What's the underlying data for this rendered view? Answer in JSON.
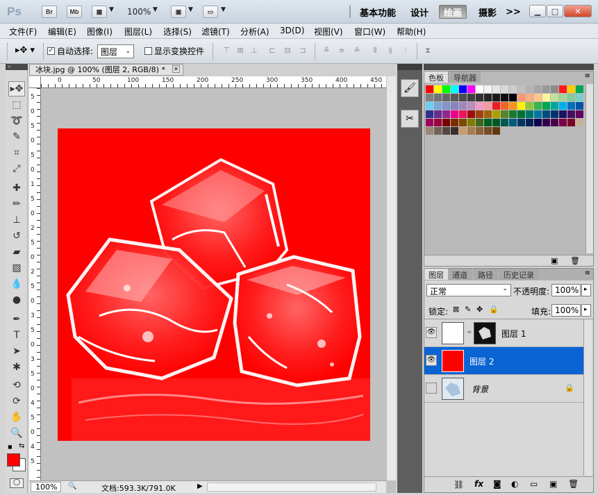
{
  "app": {
    "logo": "Ps",
    "quick_buttons": [
      "Br",
      "Mb"
    ],
    "zoom": "100%",
    "workspaces": [
      "基本功能",
      "设计",
      "绘画",
      "摄影"
    ],
    "active_workspace": "绘画",
    "more": ">>"
  },
  "menu": [
    "文件(F)",
    "编辑(E)",
    "图像(I)",
    "图层(L)",
    "选择(S)",
    "滤镜(T)",
    "分析(A)",
    "3D(D)",
    "视图(V)",
    "窗口(W)",
    "帮助(H)"
  ],
  "options": {
    "auto_select_label": "自动选择:",
    "auto_select_value": "图层",
    "show_transform_label": "显示变换控件"
  },
  "document": {
    "tab_title": "冰块.jpg @ 100% (图层 2, RGB/8) *",
    "ruler_h": [
      "0",
      "50",
      "100",
      "150",
      "200",
      "250",
      "300",
      "350",
      "400",
      "450"
    ],
    "ruler_v": [
      "5",
      "0",
      "5",
      "0",
      "5",
      "0",
      "1",
      "5",
      "0",
      "2",
      "5",
      "0",
      "2",
      "5",
      "0",
      "3",
      "5",
      "0",
      "3",
      "5",
      "0",
      "4",
      "5",
      "0",
      "4",
      "5"
    ],
    "zoom": "100%",
    "doc_size": "文档:593.3K/791.0K"
  },
  "swatches_panel": {
    "tabs": [
      "色板",
      "导航器"
    ],
    "colors": [
      "#ff0000",
      "#ffff00",
      "#00ff00",
      "#00ffff",
      "#0000ff",
      "#ff00ff",
      "#ffffff",
      "#f2f2f2",
      "#e6e6e6",
      "#d9d9d9",
      "#cccccc",
      "#bfbfbf",
      "#b3b3b3",
      "#a6a6a6",
      "#999999",
      "#8c8c8c",
      "#ff1a1a",
      "#ffcc00",
      "#00a651",
      "#808080",
      "#737373",
      "#666666",
      "#595959",
      "#4d4d4d",
      "#404040",
      "#333333",
      "#262626",
      "#1a1a1a",
      "#0d0d0d",
      "#000000",
      "#f7977a",
      "#f9ad81",
      "#fdc68a",
      "#fff79a",
      "#c4df9b",
      "#a3d39c",
      "#82ca9d",
      "#7bcdc8",
      "#6ecff6",
      "#7ea7d8",
      "#8493ca",
      "#8882be",
      "#a187be",
      "#bc8dbf",
      "#f49ac2",
      "#f6989d",
      "#ed1c24",
      "#f26522",
      "#f7941d",
      "#fff200",
      "#8dc63f",
      "#39b54a",
      "#00a651",
      "#00a99d",
      "#00aeef",
      "#0072bc",
      "#0054a6",
      "#2e3192",
      "#662d91",
      "#92278f",
      "#ec008c",
      "#ed145b",
      "#9e0b0f",
      "#a0410d",
      "#a36209",
      "#aba000",
      "#598527",
      "#197b30",
      "#007236",
      "#00746b",
      "#0076a3",
      "#004a80",
      "#003471",
      "#1b1464",
      "#440e62",
      "#630460",
      "#9e005d",
      "#9e0039",
      "#790000",
      "#7b2e00",
      "#7d4900",
      "#827b00",
      "#406618",
      "#005e20",
      "#005826",
      "#005952",
      "#005b7f",
      "#003663",
      "#002157",
      "#0d004c",
      "#32004b",
      "#4b0049",
      "#7b0046",
      "#7a0026",
      "#c7b299",
      "#998675",
      "#736357",
      "#534741",
      "#37302a",
      "#c69c6d",
      "#a67c52",
      "#8c6239",
      "#754c24",
      "#603913"
    ]
  },
  "layers_panel": {
    "tabs": [
      "图层",
      "通道",
      "路径",
      "历史记录"
    ],
    "blend_mode": "正常",
    "opacity_label": "不透明度:",
    "opacity": "100%",
    "lock_label": "锁定:",
    "fill_label": "填充:",
    "fill": "100%",
    "layers": [
      {
        "name": "图层 1",
        "selected": false,
        "visible": true
      },
      {
        "name": "图层 2",
        "selected": true,
        "visible": true
      },
      {
        "name": "背景",
        "selected": false,
        "visible": false
      }
    ]
  },
  "toolbox": {
    "foreground": "#ff0000",
    "background": "#ffffff"
  }
}
